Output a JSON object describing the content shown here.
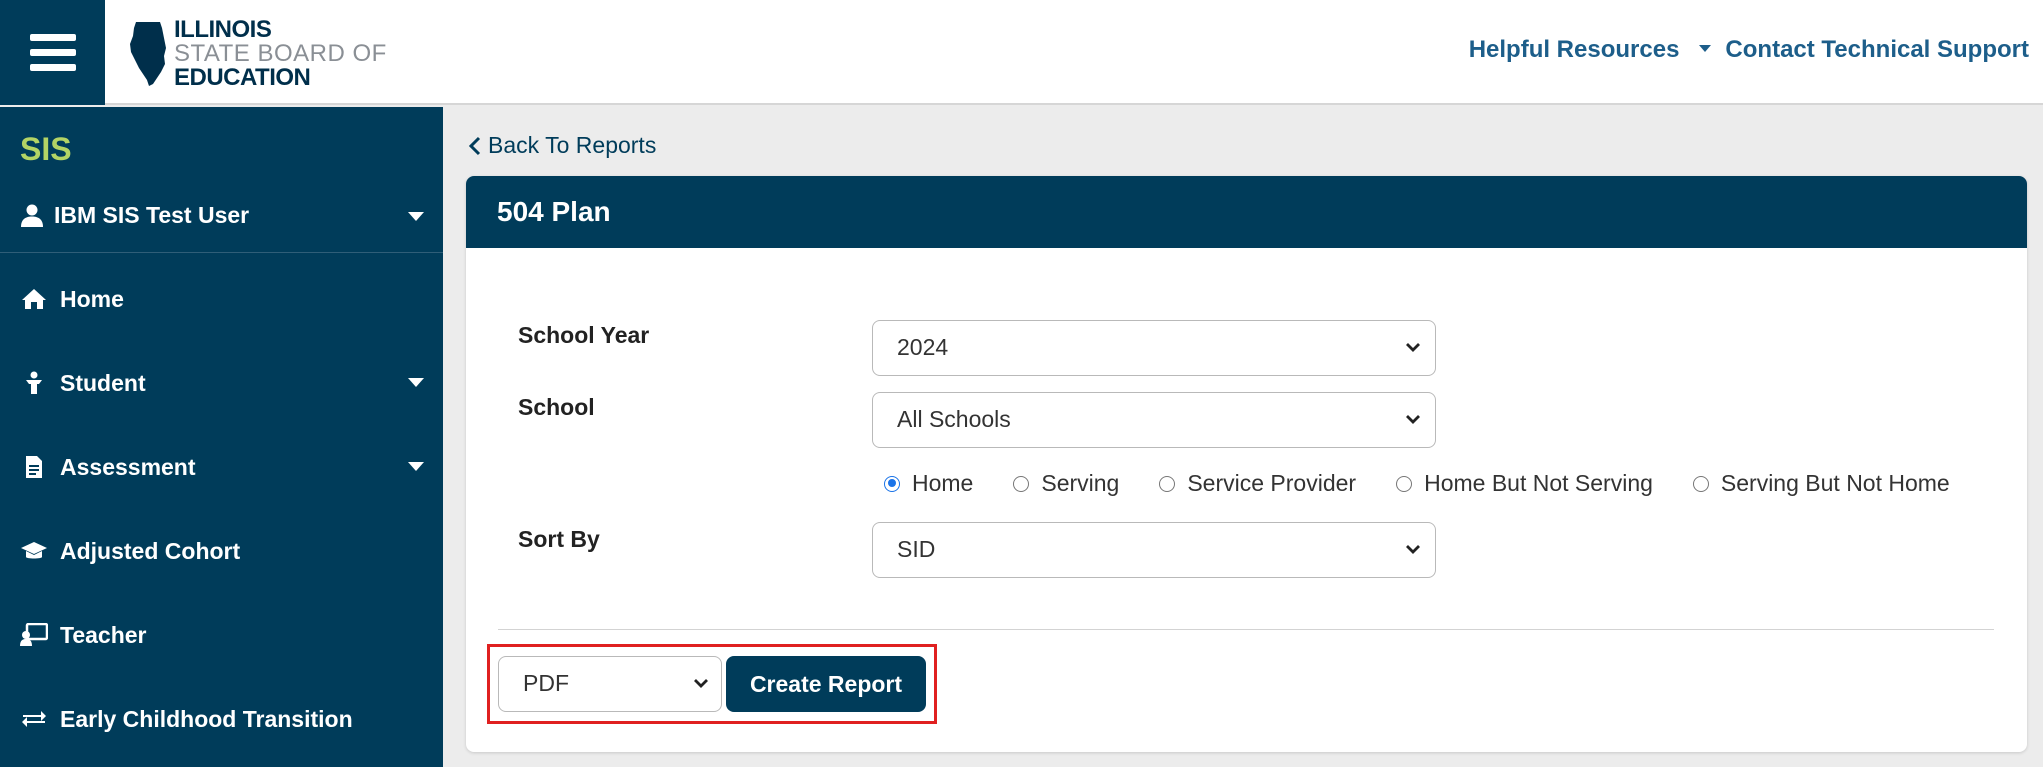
{
  "header": {
    "logo": {
      "line1": "ILLINOIS",
      "line2": "STATE BOARD OF",
      "line3": "EDUCATION"
    },
    "links": {
      "helpful_resources": "Helpful Resources",
      "contact_support": "Contact Technical Support"
    }
  },
  "sidebar": {
    "app_title": "SIS",
    "user": "IBM SIS Test User",
    "items": [
      {
        "label": "Home",
        "icon": "home-icon",
        "has_submenu": false
      },
      {
        "label": "Student",
        "icon": "student-icon",
        "has_submenu": true
      },
      {
        "label": "Assessment",
        "icon": "document-icon",
        "has_submenu": true
      },
      {
        "label": "Adjusted Cohort",
        "icon": "graduation-cap-icon",
        "has_submenu": false
      },
      {
        "label": "Teacher",
        "icon": "chalkboard-teacher-icon",
        "has_submenu": false
      },
      {
        "label": "Early Childhood Transition",
        "icon": "exchange-arrows-icon",
        "has_submenu": false
      }
    ]
  },
  "main": {
    "back_link": "Back To Reports",
    "card_title": "504 Plan",
    "fields": {
      "school_year": {
        "label": "School Year",
        "value": "2024"
      },
      "school": {
        "label": "School",
        "value": "All Schools"
      },
      "sort_by": {
        "label": "Sort By",
        "value": "SID"
      }
    },
    "radio_options": [
      {
        "label": "Home",
        "selected": true
      },
      {
        "label": "Serving",
        "selected": false
      },
      {
        "label": "Service Provider",
        "selected": false
      },
      {
        "label": "Home But Not Serving",
        "selected": false
      },
      {
        "label": "Serving But Not Home",
        "selected": false
      }
    ],
    "output_format": "PDF",
    "create_button": "Create Report"
  },
  "colors": {
    "primary": "#003c5a",
    "sis_accent": "#b3d465",
    "link": "#1d5e8a",
    "highlight": "#e02020"
  }
}
